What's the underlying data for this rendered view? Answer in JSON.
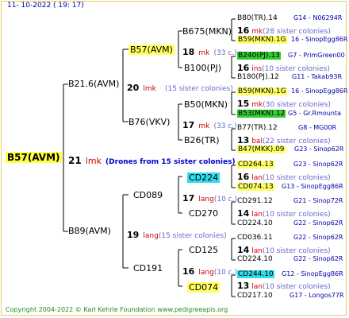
{
  "date": "11- 10-2022 ( 19: 17)",
  "root": {
    "name": "B57(AVM)",
    "num": "21",
    "type": "lmk",
    "note": "(Drones from 15 sister colonies)"
  },
  "gen1": [
    {
      "name": "B21.6(AVM)",
      "num": "20",
      "type": "lmk",
      "note": "(15 sister colonies)"
    },
    {
      "name": "B89(AVM)",
      "num": "19",
      "type": "lang",
      "note": "(15 sister colonies)"
    }
  ],
  "gen2": [
    {
      "name": "B57(AVM)",
      "num": "18",
      "type": "mk",
      "note": "(33 c.)"
    },
    {
      "name": "B76(VKV)",
      "num": "17",
      "type": "mk",
      "note": "(33 c.)"
    },
    {
      "name": "CD089",
      "num": "17",
      "type": "lang",
      "note": "(10 c.)"
    },
    {
      "name": "CD191",
      "num": "16",
      "type": "lang",
      "note": "(10 c.)"
    }
  ],
  "gen3": [
    {
      "name": "B675(MKN)",
      "num": "16",
      "type": "mk",
      "note": "(28 sister colonies)"
    },
    {
      "name": "B100(PJ)",
      "num": "16",
      "type": "ins",
      "note": "(10 sister colonies)"
    },
    {
      "name": "B50(MKN)",
      "num": "15",
      "type": "mk",
      "note": "(30 sister colonies)"
    },
    {
      "name": "B26(TR)",
      "num": "13",
      "type": "bal",
      "note": "(22 sister colonies)"
    },
    {
      "name": "CD224",
      "num": "16",
      "type": "lan",
      "note": "(10 sister colonies)"
    },
    {
      "name": "CD270",
      "num": "14",
      "type": "lan",
      "note": "(10 sister colonies)"
    },
    {
      "name": "CD125",
      "num": "14",
      "type": "lan",
      "note": "(10 sister colonies)"
    },
    {
      "name": "CD074",
      "num": "13",
      "type": "lan",
      "note": "(10 sister colonies)"
    }
  ],
  "gen4": [
    {
      "name": "B80(TR).14",
      "ref": "G14 - N06294R"
    },
    {
      "name": "B59(MKN).1G",
      "ref": "16 - SinopEgg86R"
    },
    {
      "name": "B240(PJ).13",
      "ref": "G7 - PrimGreen00"
    },
    {
      "name": "B180(PJ).12",
      "ref": "G11 - Takab93R"
    },
    {
      "name": "B59(MKN).1G",
      "ref": "16 - SinopEgg86R"
    },
    {
      "name": "B53(MKN).12",
      "ref": "G5 - Gr.Rmounta"
    },
    {
      "name": "B77(TR).12",
      "ref": "G8 - MG00R"
    },
    {
      "name": "B47(MKK).09",
      "ref": "G23 - Sinop62R"
    },
    {
      "name": "CD264.13",
      "ref": "G23 - Sinop62R"
    },
    {
      "name": "CD074.13",
      "ref": "G13 - SinopEgg86R"
    },
    {
      "name": "CD291.12",
      "ref": "G21 - Sinop72R"
    },
    {
      "name": "CD224.10",
      "ref": "G22 - Sinop62R"
    },
    {
      "name": "CD036.11",
      "ref": "G22 - Sinop62R"
    },
    {
      "name": "CD224.10",
      "ref": "G22 - Sinop62R"
    },
    {
      "name": "CD244.10",
      "ref": "G12 - SinopEgg86R"
    },
    {
      "name": "CD217.10",
      "ref": "G17 - Longos77R"
    }
  ],
  "footer": "Copyright 2004-2022 © Karl Kehrle Foundation   www.pedigreeapis.org",
  "colors": {
    "highlight_yellow": "#ffff66",
    "highlight_cyan": "#33ddee",
    "highlight_green": "#33cc33",
    "red": "#cc0000",
    "blue": "#0000aa"
  }
}
